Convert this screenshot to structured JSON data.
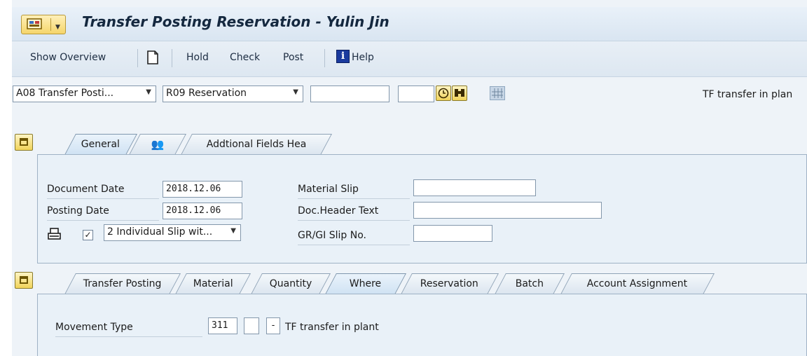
{
  "window": {
    "title": "Transfer Posting Reservation - Yulin Jin"
  },
  "toolbar": {
    "show_overview": "Show Overview",
    "hold": "Hold",
    "check": "Check",
    "post": "Post",
    "help": "Help",
    "help_icon_glyph": "i"
  },
  "selection": {
    "action": "A08 Transfer Posti...",
    "reference": "R09 Reservation",
    "ref_doc_value": "",
    "ref_item_value": "",
    "right_label": "TF transfer in plan"
  },
  "header_tabs": {
    "general": "General",
    "addtional": "Addtional Fields Hea"
  },
  "general": {
    "document_date_label": "Document Date",
    "document_date": "2018.12.06",
    "posting_date_label": "Posting Date",
    "posting_date": "2018.12.06",
    "print_checked": "✓",
    "slip_option": "2 Individual Slip wit...",
    "material_slip_label": "Material Slip",
    "material_slip": "",
    "doc_header_text_label": "Doc.Header Text",
    "doc_header_text": "",
    "grgi_slip_label": "GR/GI Slip No.",
    "grgi_slip": ""
  },
  "item_tabs": {
    "transfer_posting": "Transfer Posting",
    "material": "Material",
    "quantity": "Quantity",
    "where": "Where",
    "reservation": "Reservation",
    "batch": "Batch",
    "account_assignment": "Account Assignment"
  },
  "where": {
    "movement_type_label": "Movement Type",
    "movement_type": "311",
    "special_stock": "",
    "reversal": "-",
    "movement_text": "TF transfer in plant"
  },
  "colors": {
    "title_bar": "#dde8f3",
    "button_yellow": "#f0d35a",
    "panel_bg": "#e9f1f8"
  }
}
